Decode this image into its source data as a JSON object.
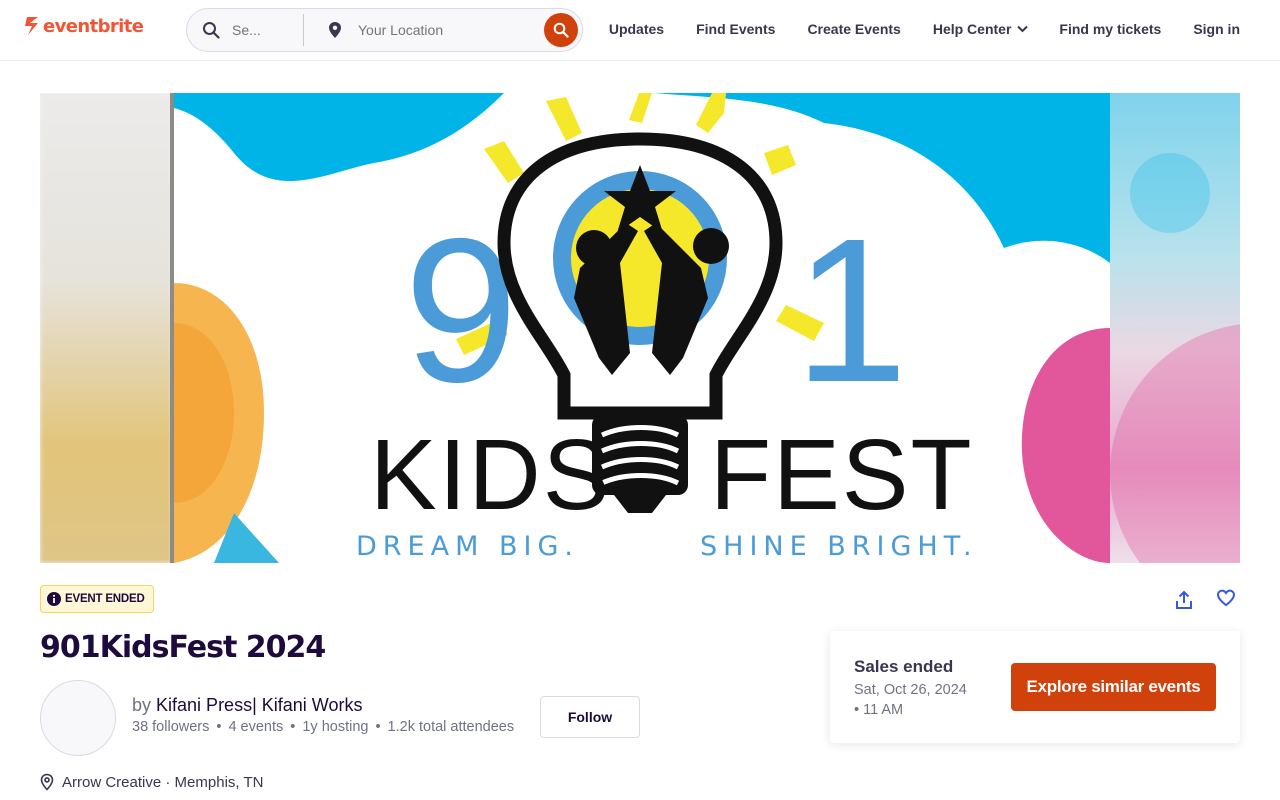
{
  "header": {
    "brand": "eventbrite",
    "search_placeholder": "Se...",
    "location_placeholder": "Your Location",
    "nav": [
      {
        "label": "Updates"
      },
      {
        "label": "Find Events"
      },
      {
        "label": "Create Events"
      },
      {
        "label": "Help Center",
        "has_dropdown": true
      },
      {
        "label": "Find my tickets"
      },
      {
        "label": "Sign in"
      }
    ]
  },
  "hero": {
    "logo_number_left": "9",
    "logo_number_right": "1",
    "logo_word_left": "KIDS",
    "logo_word_right": "FEST",
    "tagline_left": "DREAM BIG.",
    "tagline_right": "SHINE BRIGHT."
  },
  "event": {
    "status_badge": "EVENT ENDED",
    "title": "901KidsFest 2024",
    "organizer_prefix": "by",
    "organizer_name": "Kifani Press| Kifani Works",
    "stats": [
      "38 followers",
      "4 events",
      "1y hosting",
      "1.2k total attendees"
    ],
    "follow_label": "Follow",
    "venue": "Arrow Creative",
    "venue_separator": "·",
    "city": "Memphis, TN"
  },
  "sales": {
    "title": "Sales ended",
    "date": "Sat, Oct 26, 2024",
    "time": "• 11 AM",
    "cta_label": "Explore similar events"
  },
  "colors": {
    "brand": "#f05537",
    "cta": "#d1410c",
    "text_dark": "#1e0a3c",
    "badge_bg": "#fff7d6",
    "logo_blue": "#4a9bd8",
    "logo_yellow": "#f5e82a",
    "sky_blue": "#00b4e8",
    "pink": "#e2569b"
  },
  "icons": [
    "eventbrite-logo-icon",
    "search-icon",
    "location-pin-icon",
    "chevron-down-icon",
    "info-icon",
    "share-icon",
    "heart-icon"
  ]
}
